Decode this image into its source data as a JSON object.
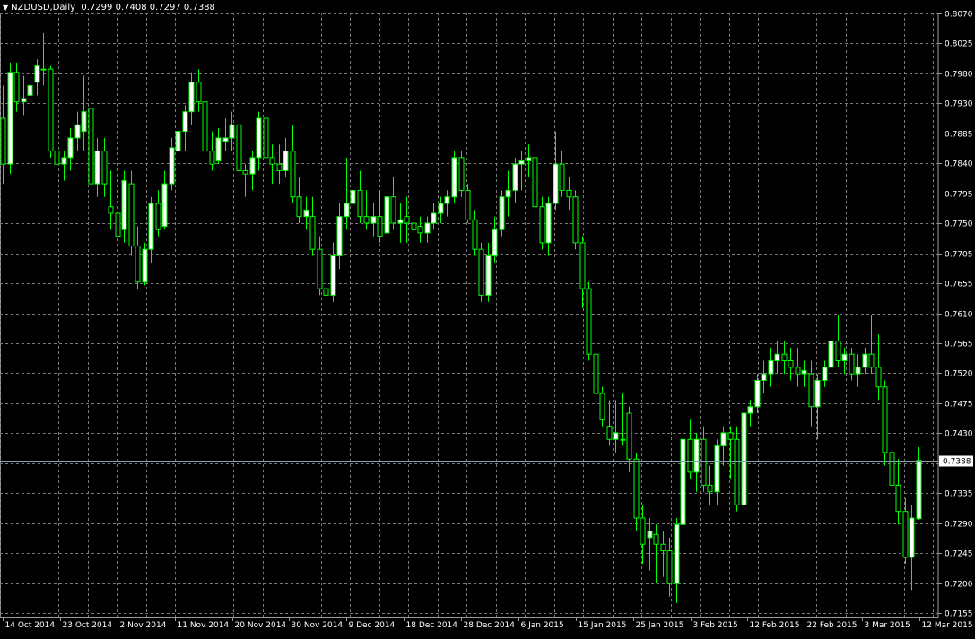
{
  "header": {
    "symbol": "NZDUSD,Daily",
    "ohlc": "0.7299 0.7408 0.7297 0.7388"
  },
  "price_axis": {
    "ticks": [
      "0.8070",
      "0.8025",
      "0.7980",
      "0.7930",
      "0.7885",
      "0.7840",
      "0.7795",
      "0.7750",
      "0.7705",
      "0.7655",
      "0.7610",
      "0.7565",
      "0.7520",
      "0.7475",
      "0.7430",
      "0.7385",
      "0.7335",
      "0.7290",
      "0.7245",
      "0.7200",
      "0.7155"
    ],
    "current_price_label": "0.7388"
  },
  "time_axis": {
    "labels": [
      "14 Oct 2014",
      "23 Oct 2014",
      "2 Nov 2014",
      "11 Nov 2014",
      "20 Nov 2014",
      "30 Nov 2014",
      "9 Dec 2014",
      "18 Dec 2014",
      "28 Dec 2014",
      "6 Jan 2015",
      "15 Jan 2015",
      "25 Jan 2015",
      "3 Feb 2015",
      "12 Feb 2015",
      "22 Feb 2015",
      "3 Mar 2015",
      "12 Mar 2015"
    ]
  },
  "colors": {
    "background": "#000000",
    "grid": "#7a7a7a",
    "bull_body": "#ffffff",
    "wick": "#00ff00",
    "current_price_line": "#8aa0b0",
    "text": "#ffffff"
  },
  "chart_data": {
    "type": "candlestick",
    "symbol": "NZDUSD",
    "timeframe": "Daily",
    "ylim": [
      0.7155,
      0.807
    ],
    "grid": true,
    "current_price": 0.7388,
    "candles": [
      {
        "o": 0.791,
        "h": 0.796,
        "l": 0.781,
        "c": 0.784
      },
      {
        "o": 0.784,
        "h": 0.7995,
        "l": 0.7825,
        "c": 0.798
      },
      {
        "o": 0.798,
        "h": 0.7995,
        "l": 0.792,
        "c": 0.7935
      },
      {
        "o": 0.7935,
        "h": 0.7975,
        "l": 0.7915,
        "c": 0.794
      },
      {
        "o": 0.7945,
        "h": 0.7985,
        "l": 0.7925,
        "c": 0.796
      },
      {
        "o": 0.7965,
        "h": 0.8,
        "l": 0.7945,
        "c": 0.799
      },
      {
        "o": 0.7985,
        "h": 0.804,
        "l": 0.796,
        "c": 0.7985
      },
      {
        "o": 0.7985,
        "h": 0.799,
        "l": 0.785,
        "c": 0.786
      },
      {
        "o": 0.786,
        "h": 0.788,
        "l": 0.78,
        "c": 0.784
      },
      {
        "o": 0.784,
        "h": 0.786,
        "l": 0.7815,
        "c": 0.785
      },
      {
        "o": 0.785,
        "h": 0.7895,
        "l": 0.783,
        "c": 0.788
      },
      {
        "o": 0.788,
        "h": 0.792,
        "l": 0.786,
        "c": 0.79
      },
      {
        "o": 0.789,
        "h": 0.7975,
        "l": 0.786,
        "c": 0.792
      },
      {
        "o": 0.7925,
        "h": 0.7975,
        "l": 0.779,
        "c": 0.781
      },
      {
        "o": 0.781,
        "h": 0.788,
        "l": 0.779,
        "c": 0.786
      },
      {
        "o": 0.786,
        "h": 0.788,
        "l": 0.779,
        "c": 0.781
      },
      {
        "o": 0.7775,
        "h": 0.783,
        "l": 0.774,
        "c": 0.7765
      },
      {
        "o": 0.7765,
        "h": 0.779,
        "l": 0.771,
        "c": 0.773
      },
      {
        "o": 0.774,
        "h": 0.783,
        "l": 0.772,
        "c": 0.7815
      },
      {
        "o": 0.781,
        "h": 0.783,
        "l": 0.77,
        "c": 0.7715
      },
      {
        "o": 0.7715,
        "h": 0.7745,
        "l": 0.765,
        "c": 0.766
      },
      {
        "o": 0.766,
        "h": 0.772,
        "l": 0.7655,
        "c": 0.771
      },
      {
        "o": 0.771,
        "h": 0.779,
        "l": 0.769,
        "c": 0.778
      },
      {
        "o": 0.778,
        "h": 0.78,
        "l": 0.773,
        "c": 0.774
      },
      {
        "o": 0.7745,
        "h": 0.783,
        "l": 0.774,
        "c": 0.781
      },
      {
        "o": 0.781,
        "h": 0.788,
        "l": 0.78,
        "c": 0.7865
      },
      {
        "o": 0.786,
        "h": 0.791,
        "l": 0.782,
        "c": 0.789
      },
      {
        "o": 0.789,
        "h": 0.793,
        "l": 0.786,
        "c": 0.792
      },
      {
        "o": 0.792,
        "h": 0.798,
        "l": 0.79,
        "c": 0.7965
      },
      {
        "o": 0.7965,
        "h": 0.7985,
        "l": 0.792,
        "c": 0.7935
      },
      {
        "o": 0.7935,
        "h": 0.795,
        "l": 0.785,
        "c": 0.786
      },
      {
        "o": 0.786,
        "h": 0.789,
        "l": 0.783,
        "c": 0.784
      },
      {
        "o": 0.7845,
        "h": 0.7895,
        "l": 0.784,
        "c": 0.788
      },
      {
        "o": 0.7875,
        "h": 0.791,
        "l": 0.786,
        "c": 0.788
      },
      {
        "o": 0.788,
        "h": 0.792,
        "l": 0.786,
        "c": 0.79
      },
      {
        "o": 0.79,
        "h": 0.792,
        "l": 0.781,
        "c": 0.783
      },
      {
        "o": 0.783,
        "h": 0.784,
        "l": 0.779,
        "c": 0.7825
      },
      {
        "o": 0.7825,
        "h": 0.786,
        "l": 0.78,
        "c": 0.785
      },
      {
        "o": 0.785,
        "h": 0.792,
        "l": 0.783,
        "c": 0.791
      },
      {
        "o": 0.791,
        "h": 0.793,
        "l": 0.784,
        "c": 0.785
      },
      {
        "o": 0.785,
        "h": 0.787,
        "l": 0.781,
        "c": 0.784
      },
      {
        "o": 0.784,
        "h": 0.787,
        "l": 0.781,
        "c": 0.783
      },
      {
        "o": 0.783,
        "h": 0.788,
        "l": 0.782,
        "c": 0.786
      },
      {
        "o": 0.786,
        "h": 0.79,
        "l": 0.778,
        "c": 0.779
      },
      {
        "o": 0.779,
        "h": 0.782,
        "l": 0.775,
        "c": 0.776
      },
      {
        "o": 0.776,
        "h": 0.779,
        "l": 0.774,
        "c": 0.777
      },
      {
        "o": 0.776,
        "h": 0.779,
        "l": 0.77,
        "c": 0.771
      },
      {
        "o": 0.771,
        "h": 0.773,
        "l": 0.764,
        "c": 0.765
      },
      {
        "o": 0.765,
        "h": 0.77,
        "l": 0.762,
        "c": 0.764
      },
      {
        "o": 0.764,
        "h": 0.772,
        "l": 0.763,
        "c": 0.77
      },
      {
        "o": 0.77,
        "h": 0.778,
        "l": 0.768,
        "c": 0.776
      },
      {
        "o": 0.776,
        "h": 0.785,
        "l": 0.774,
        "c": 0.778
      },
      {
        "o": 0.778,
        "h": 0.783,
        "l": 0.774,
        "c": 0.78
      },
      {
        "o": 0.78,
        "h": 0.783,
        "l": 0.775,
        "c": 0.776
      },
      {
        "o": 0.776,
        "h": 0.78,
        "l": 0.774,
        "c": 0.775
      },
      {
        "o": 0.775,
        "h": 0.778,
        "l": 0.773,
        "c": 0.776
      },
      {
        "o": 0.776,
        "h": 0.78,
        "l": 0.772,
        "c": 0.773
      },
      {
        "o": 0.7735,
        "h": 0.78,
        "l": 0.772,
        "c": 0.779
      },
      {
        "o": 0.779,
        "h": 0.782,
        "l": 0.774,
        "c": 0.775
      },
      {
        "o": 0.775,
        "h": 0.778,
        "l": 0.772,
        "c": 0.7755
      },
      {
        "o": 0.776,
        "h": 0.779,
        "l": 0.772,
        "c": 0.775
      },
      {
        "o": 0.775,
        "h": 0.777,
        "l": 0.771,
        "c": 0.774
      },
      {
        "o": 0.7745,
        "h": 0.776,
        "l": 0.772,
        "c": 0.7735
      },
      {
        "o": 0.7735,
        "h": 0.776,
        "l": 0.772,
        "c": 0.775
      },
      {
        "o": 0.775,
        "h": 0.778,
        "l": 0.774,
        "c": 0.7765
      },
      {
        "o": 0.7765,
        "h": 0.779,
        "l": 0.775,
        "c": 0.778
      },
      {
        "o": 0.778,
        "h": 0.78,
        "l": 0.776,
        "c": 0.779
      },
      {
        "o": 0.779,
        "h": 0.786,
        "l": 0.778,
        "c": 0.785
      },
      {
        "o": 0.785,
        "h": 0.786,
        "l": 0.779,
        "c": 0.78
      },
      {
        "o": 0.78,
        "h": 0.781,
        "l": 0.775,
        "c": 0.7755
      },
      {
        "o": 0.7755,
        "h": 0.777,
        "l": 0.77,
        "c": 0.771
      },
      {
        "o": 0.771,
        "h": 0.772,
        "l": 0.763,
        "c": 0.764
      },
      {
        "o": 0.764,
        "h": 0.772,
        "l": 0.763,
        "c": 0.77
      },
      {
        "o": 0.77,
        "h": 0.776,
        "l": 0.769,
        "c": 0.774
      },
      {
        "o": 0.774,
        "h": 0.78,
        "l": 0.773,
        "c": 0.779
      },
      {
        "o": 0.779,
        "h": 0.783,
        "l": 0.776,
        "c": 0.78
      },
      {
        "o": 0.78,
        "h": 0.785,
        "l": 0.778,
        "c": 0.784
      },
      {
        "o": 0.784,
        "h": 0.786,
        "l": 0.78,
        "c": 0.7845
      },
      {
        "o": 0.7845,
        "h": 0.787,
        "l": 0.782,
        "c": 0.785
      },
      {
        "o": 0.785,
        "h": 0.787,
        "l": 0.776,
        "c": 0.7775
      },
      {
        "o": 0.7775,
        "h": 0.779,
        "l": 0.771,
        "c": 0.772
      },
      {
        "o": 0.772,
        "h": 0.779,
        "l": 0.77,
        "c": 0.778
      },
      {
        "o": 0.778,
        "h": 0.789,
        "l": 0.777,
        "c": 0.784
      },
      {
        "o": 0.784,
        "h": 0.786,
        "l": 0.779,
        "c": 0.78
      },
      {
        "o": 0.78,
        "h": 0.782,
        "l": 0.777,
        "c": 0.779
      },
      {
        "o": 0.779,
        "h": 0.78,
        "l": 0.771,
        "c": 0.772
      },
      {
        "o": 0.772,
        "h": 0.773,
        "l": 0.762,
        "c": 0.765
      },
      {
        "o": 0.765,
        "h": 0.766,
        "l": 0.754,
        "c": 0.755
      },
      {
        "o": 0.755,
        "h": 0.756,
        "l": 0.748,
        "c": 0.749
      },
      {
        "o": 0.749,
        "h": 0.75,
        "l": 0.744,
        "c": 0.745
      },
      {
        "o": 0.744,
        "h": 0.748,
        "l": 0.741,
        "c": 0.742
      },
      {
        "o": 0.742,
        "h": 0.748,
        "l": 0.74,
        "c": 0.743
      },
      {
        "o": 0.742,
        "h": 0.749,
        "l": 0.741,
        "c": 0.742
      },
      {
        "o": 0.746,
        "h": 0.747,
        "l": 0.737,
        "c": 0.739
      },
      {
        "o": 0.739,
        "h": 0.74,
        "l": 0.728,
        "c": 0.73
      },
      {
        "o": 0.73,
        "h": 0.732,
        "l": 0.723,
        "c": 0.726
      },
      {
        "o": 0.727,
        "h": 0.73,
        "l": 0.722,
        "c": 0.728
      },
      {
        "o": 0.7275,
        "h": 0.729,
        "l": 0.72,
        "c": 0.726
      },
      {
        "o": 0.726,
        "h": 0.728,
        "l": 0.721,
        "c": 0.725
      },
      {
        "o": 0.725,
        "h": 0.727,
        "l": 0.718,
        "c": 0.72
      },
      {
        "o": 0.72,
        "h": 0.73,
        "l": 0.717,
        "c": 0.729
      },
      {
        "o": 0.729,
        "h": 0.744,
        "l": 0.728,
        "c": 0.742
      },
      {
        "o": 0.742,
        "h": 0.745,
        "l": 0.736,
        "c": 0.737
      },
      {
        "o": 0.737,
        "h": 0.743,
        "l": 0.734,
        "c": 0.742
      },
      {
        "o": 0.742,
        "h": 0.744,
        "l": 0.734,
        "c": 0.735
      },
      {
        "o": 0.735,
        "h": 0.738,
        "l": 0.732,
        "c": 0.734
      },
      {
        "o": 0.734,
        "h": 0.742,
        "l": 0.732,
        "c": 0.741
      },
      {
        "o": 0.741,
        "h": 0.744,
        "l": 0.738,
        "c": 0.743
      },
      {
        "o": 0.743,
        "h": 0.744,
        "l": 0.736,
        "c": 0.742
      },
      {
        "o": 0.742,
        "h": 0.744,
        "l": 0.731,
        "c": 0.732
      },
      {
        "o": 0.732,
        "h": 0.748,
        "l": 0.731,
        "c": 0.746
      },
      {
        "o": 0.746,
        "h": 0.748,
        "l": 0.744,
        "c": 0.747
      },
      {
        "o": 0.747,
        "h": 0.752,
        "l": 0.746,
        "c": 0.751
      },
      {
        "o": 0.751,
        "h": 0.754,
        "l": 0.749,
        "c": 0.752
      },
      {
        "o": 0.752,
        "h": 0.756,
        "l": 0.75,
        "c": 0.754
      },
      {
        "o": 0.754,
        "h": 0.757,
        "l": 0.752,
        "c": 0.755
      },
      {
        "o": 0.755,
        "h": 0.757,
        "l": 0.752,
        "c": 0.754
      },
      {
        "o": 0.754,
        "h": 0.756,
        "l": 0.751,
        "c": 0.753
      },
      {
        "o": 0.753,
        "h": 0.756,
        "l": 0.75,
        "c": 0.752
      },
      {
        "o": 0.752,
        "h": 0.754,
        "l": 0.75,
        "c": 0.7525
      },
      {
        "o": 0.752,
        "h": 0.754,
        "l": 0.744,
        "c": 0.747
      },
      {
        "o": 0.747,
        "h": 0.752,
        "l": 0.742,
        "c": 0.751
      },
      {
        "o": 0.751,
        "h": 0.754,
        "l": 0.75,
        "c": 0.753
      },
      {
        "o": 0.753,
        "h": 0.758,
        "l": 0.752,
        "c": 0.757
      },
      {
        "o": 0.757,
        "h": 0.761,
        "l": 0.753,
        "c": 0.754
      },
      {
        "o": 0.754,
        "h": 0.756,
        "l": 0.752,
        "c": 0.755
      },
      {
        "o": 0.755,
        "h": 0.756,
        "l": 0.751,
        "c": 0.752
      },
      {
        "o": 0.752,
        "h": 0.755,
        "l": 0.75,
        "c": 0.753
      },
      {
        "o": 0.753,
        "h": 0.756,
        "l": 0.752,
        "c": 0.755
      },
      {
        "o": 0.755,
        "h": 0.761,
        "l": 0.752,
        "c": 0.753
      },
      {
        "o": 0.753,
        "h": 0.758,
        "l": 0.748,
        "c": 0.75
      },
      {
        "o": 0.75,
        "h": 0.751,
        "l": 0.738,
        "c": 0.74
      },
      {
        "o": 0.74,
        "h": 0.742,
        "l": 0.733,
        "c": 0.735
      },
      {
        "o": 0.735,
        "h": 0.739,
        "l": 0.729,
        "c": 0.731
      },
      {
        "o": 0.731,
        "h": 0.733,
        "l": 0.723,
        "c": 0.724
      },
      {
        "o": 0.724,
        "h": 0.732,
        "l": 0.719,
        "c": 0.73
      },
      {
        "o": 0.7299,
        "h": 0.7408,
        "l": 0.7297,
        "c": 0.7388
      }
    ]
  }
}
